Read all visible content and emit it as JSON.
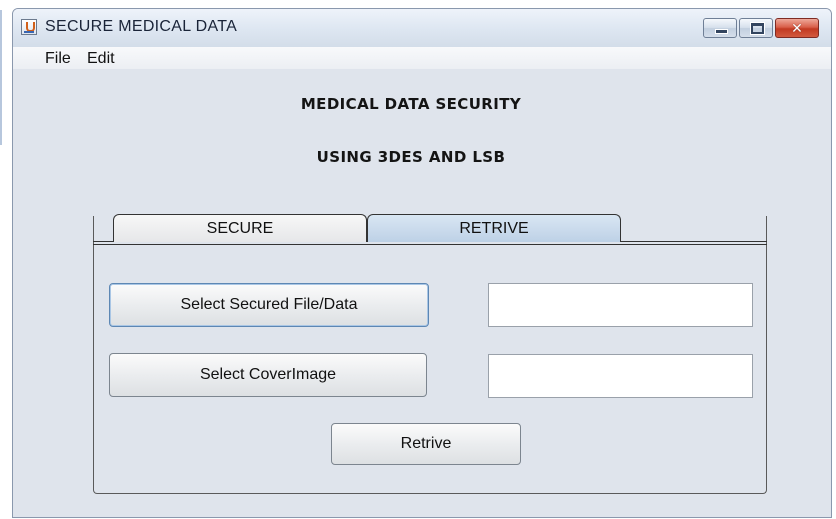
{
  "window": {
    "title": "SECURE MEDICAL DATA",
    "icon": "java-cup-icon",
    "controls": {
      "minimize": "minimize-icon",
      "maximize": "maximize-icon",
      "close": "close-icon",
      "close_glyph": "✕"
    }
  },
  "menu": {
    "items": [
      {
        "label": "File"
      },
      {
        "label": "Edit"
      }
    ]
  },
  "header": {
    "line1": "MEDICAL DATA SECURITY",
    "line2": "USING 3DES AND LSB"
  },
  "tabs": [
    {
      "label": "SECURE",
      "selected": false
    },
    {
      "label": "RETRIVE",
      "selected": true
    }
  ],
  "retrive_panel": {
    "select_secured_label": "Select Secured File/Data",
    "select_cover_label": "Select CoverImage",
    "retrive_label": "Retrive",
    "secured_path_value": "",
    "cover_path_value": ""
  },
  "colors": {
    "selected_tab": "#bdd1e6",
    "close_button": "#c23a22",
    "focus_border": "#5d87b4"
  }
}
